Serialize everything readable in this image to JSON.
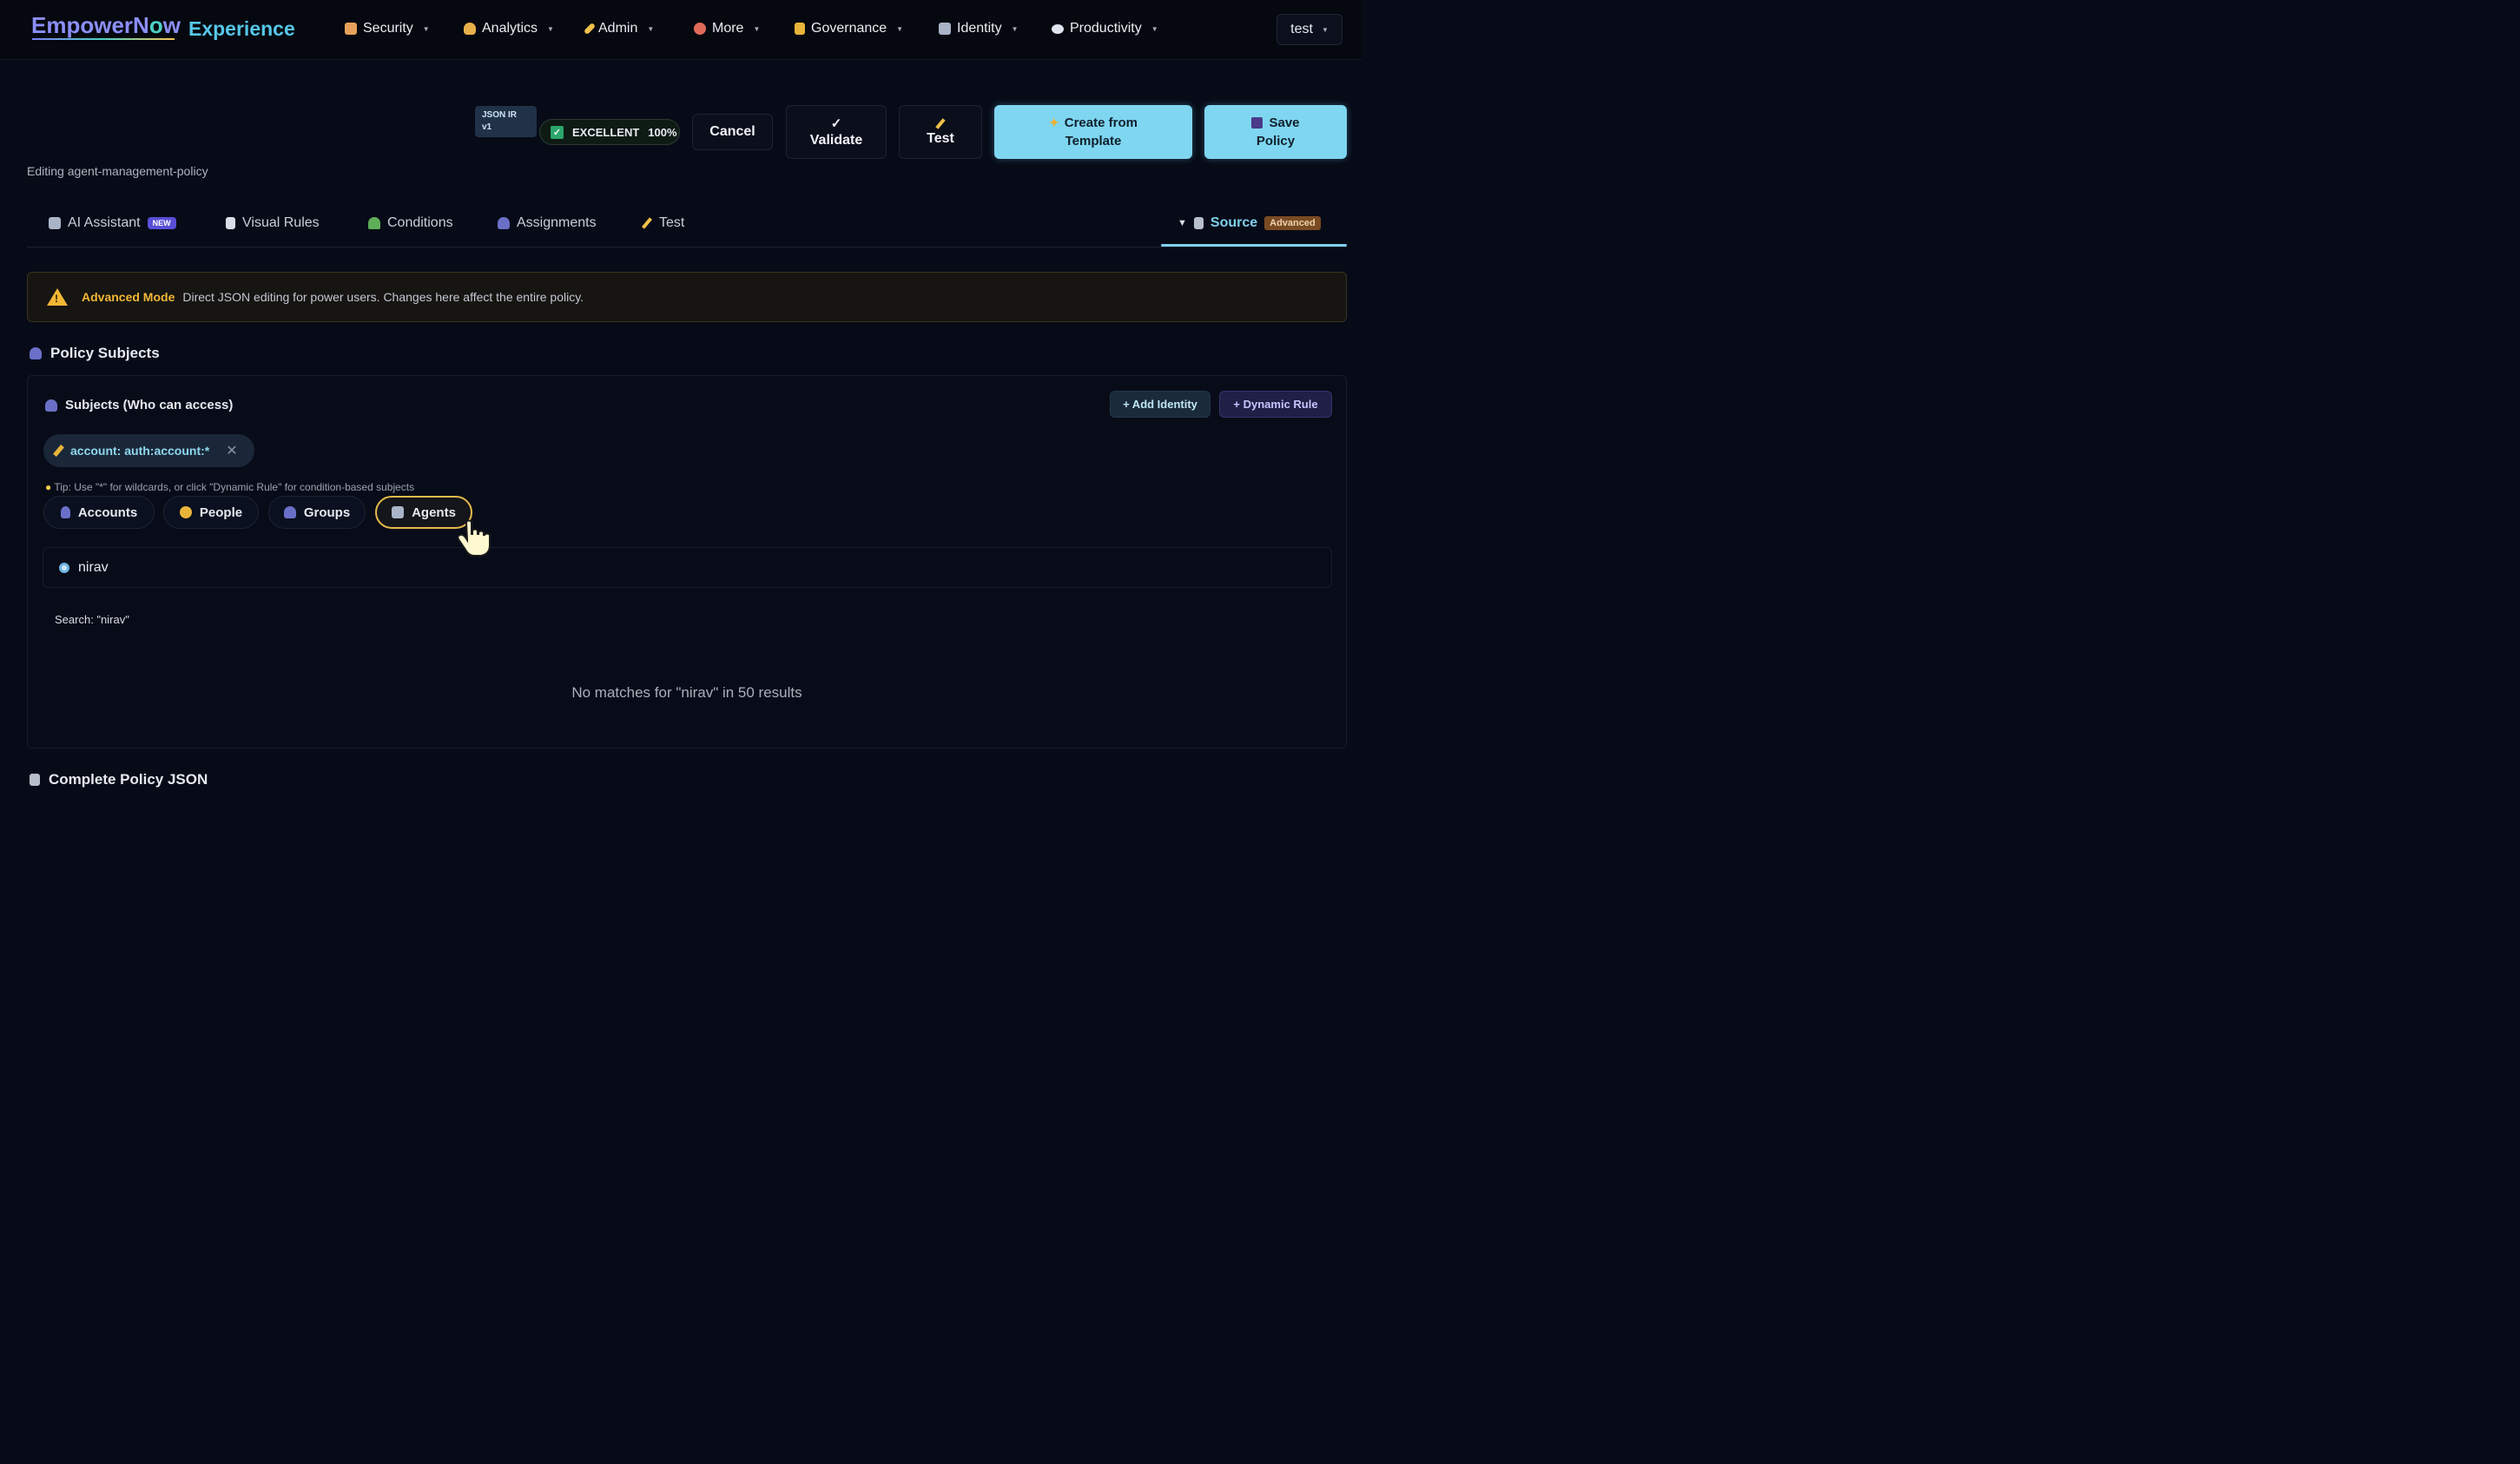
{
  "brand": {
    "name_pre": "EmpowerN",
    "name_o": "o",
    "name_post": "w",
    "suffix": "Experience"
  },
  "nav": [
    {
      "label": "Security",
      "icon": "shield-icon",
      "color": "#e6a25a"
    },
    {
      "label": "Analytics",
      "icon": "money-bag-icon",
      "color": "#e8b04a"
    },
    {
      "label": "Admin",
      "icon": "wrench-icon",
      "color": "#f0c04a"
    },
    {
      "label": "More",
      "icon": "circle-icon",
      "color": "#e06a5a"
    },
    {
      "label": "Governance",
      "icon": "lock-icon",
      "color": "#e8b43a"
    },
    {
      "label": "Identity",
      "icon": "robot-icon",
      "color": "#aab4c8"
    },
    {
      "label": "Productivity",
      "icon": "speech-bubble-icon",
      "color": "#dfe4ee"
    }
  ],
  "user_menu": {
    "label": "test"
  },
  "toolbar": {
    "format_badge_line1": "JSON IR",
    "format_badge_line2": "v1",
    "quality_label": "EXCELLENT",
    "quality_score": "100%",
    "cancel_label": "Cancel",
    "validate_icon": "✓",
    "validate_label": "Validate",
    "test_label": "Test",
    "create_template_line1": "Create from",
    "create_template_line2": "Template",
    "save_line1": "Save",
    "save_line2": "Policy"
  },
  "editing_text": "Editing agent-management-policy",
  "tabs": {
    "ai_assistant": "AI Assistant",
    "ai_badge": "NEW",
    "visual_rules": "Visual Rules",
    "conditions": "Conditions",
    "assignments": "Assignments",
    "test": "Test",
    "source": "Source",
    "source_badge": "Advanced"
  },
  "warning": {
    "title": "Advanced Mode",
    "text": "Direct JSON editing for power users. Changes here affect the entire policy."
  },
  "policy_subjects": {
    "title": "Policy Subjects",
    "subjects_title": "Subjects (Who can access)",
    "add_identity_label": "+ Add Identity",
    "dynamic_rule_label": "+ Dynamic Rule",
    "chip_label": "account: auth:account:*",
    "tip": "Tip: Use \"*\" for wildcards, or click \"Dynamic Rule\" for condition-based subjects",
    "filters": {
      "accounts": "Accounts",
      "people": "People",
      "groups": "Groups",
      "agents": "Agents"
    },
    "search_value": "nirav",
    "search_summary": "Search: \"nirav\"",
    "no_match_text": "No matches for \"nirav\" in 50 results"
  },
  "footer_title": "Complete Policy JSON",
  "colors": {
    "accent": "#7fd0ec",
    "warning": "#f2b735",
    "active_filter": "#e6b94a"
  }
}
